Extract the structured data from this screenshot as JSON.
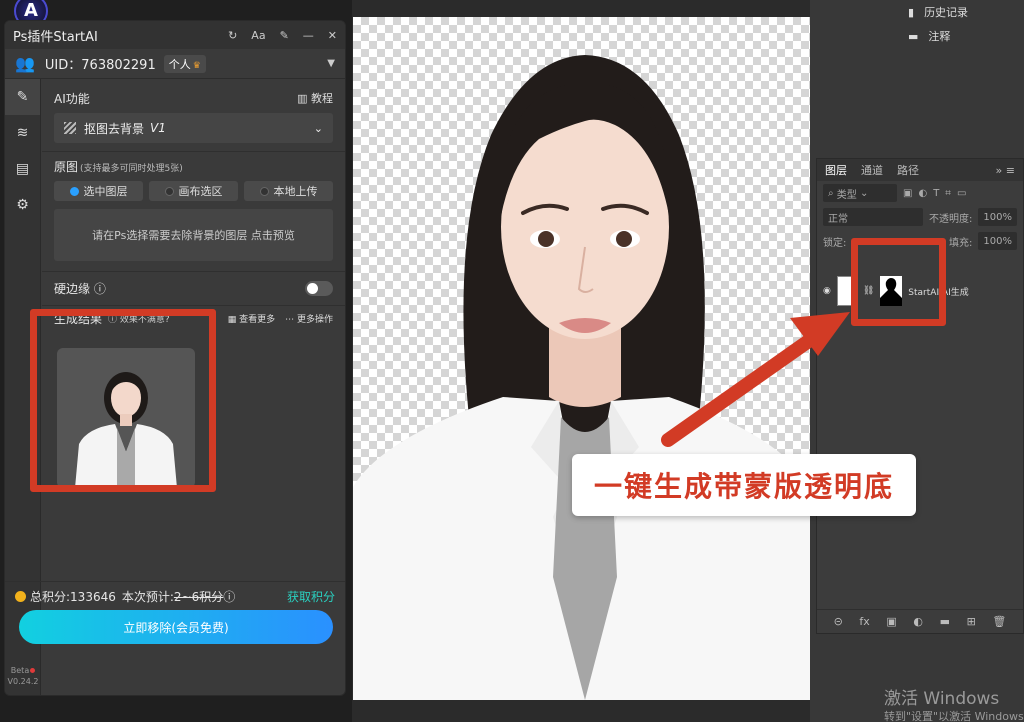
{
  "plugin": {
    "title": "Ps插件StartAI",
    "font_btn": "Aa",
    "uid": "UID：763802291",
    "plan_badge": "个人",
    "ai_label": "AI功能",
    "tutorial": "教程",
    "mode_select": "抠图去背景",
    "mode_version": "V1",
    "source_title": "原图",
    "source_hint": "(支持最多可同时处理5张)",
    "source_options": [
      "选中图层",
      "画布选区",
      "本地上传"
    ],
    "drop_hint": "请在Ps选择需要去除背景的图层 点击预览",
    "hard_edge": "硬边缘",
    "result_title": "生成结果",
    "result_hint": "效果不满意?",
    "view_more": "查看更多",
    "more_actions": "更多操作",
    "total_points": "总积分:133646",
    "est_label": "本次预计:",
    "est_value": "2~6积分",
    "get_points": "获取积分",
    "cta": "立即移除(会员免费)",
    "beta": "Beta",
    "version": "V0.24.2"
  },
  "history": {
    "items": [
      "历史记录",
      "注释"
    ]
  },
  "layers": {
    "tabs": [
      "图层",
      "通道",
      "路径"
    ],
    "kind": "类型",
    "blend": "正常",
    "opacity_label": "不透明度:",
    "opacity_value": "100%",
    "lock_label": "锁定:",
    "fill_label": "填充:",
    "fill_value": "100%",
    "layer_name": "StartAI AI生成"
  },
  "callout": "一键生成带蒙版透明底",
  "watermark": {
    "title": "激活 Windows",
    "sub": "转到\"设置\"以激活 Windows。"
  },
  "colors": {
    "accent_red": "#d23b25",
    "cta_start": "#12d0e0",
    "cta_end": "#2a90ff"
  }
}
